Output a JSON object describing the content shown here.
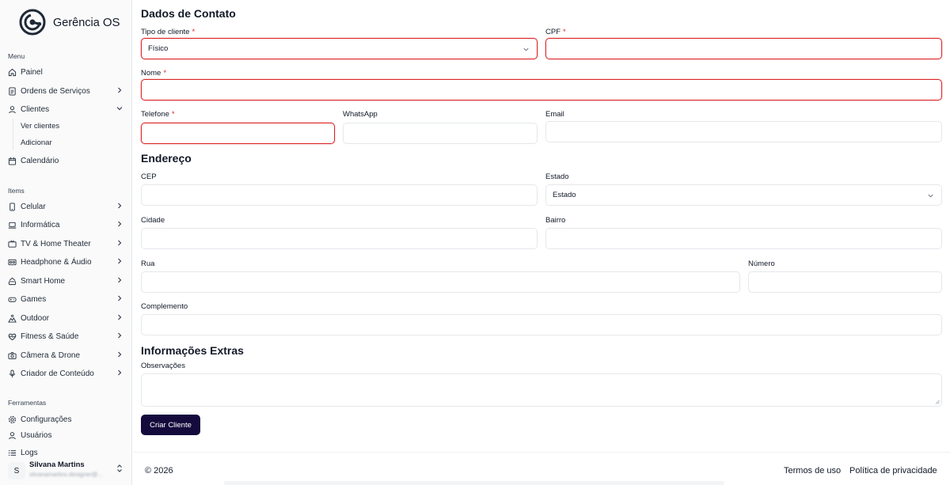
{
  "app": {
    "logo_main": "Gerência",
    "logo_bold": "OS"
  },
  "sidebar": {
    "menu_label": "Menu",
    "menu_items": [
      {
        "label": "Painel",
        "icon": "home-icon"
      },
      {
        "label": "Ordens de Serviços",
        "icon": "document-icon"
      },
      {
        "label": "Clientes",
        "icon": "user-icon"
      }
    ],
    "clientes_sub": [
      "Ver clientes",
      "Adicionar"
    ],
    "calendar_label": "Calendário",
    "items_label": "Items",
    "items": [
      {
        "label": "Celular",
        "icon": "smartphone-icon"
      },
      {
        "label": "Informática",
        "icon": "laptop-icon"
      },
      {
        "label": "TV & Home Theater",
        "icon": "tv-icon"
      },
      {
        "label": "Headphone & Áudio",
        "icon": "speaker-icon"
      },
      {
        "label": "Smart Home",
        "icon": "smart-home-icon"
      },
      {
        "label": "Games",
        "icon": "gamepad-icon"
      },
      {
        "label": "Outdoor",
        "icon": "outdoor-icon"
      },
      {
        "label": "Fitness & Saúde",
        "icon": "heart-pulse-icon"
      },
      {
        "label": "Câmera & Drone",
        "icon": "camera-icon"
      },
      {
        "label": "Criador de Conteúdo",
        "icon": "mic-icon"
      }
    ],
    "tools_label": "Ferramentas",
    "tools": [
      {
        "label": "Configurações",
        "icon": "gear-icon"
      },
      {
        "label": "Usuários",
        "icon": "user-icon"
      },
      {
        "label": "Logs",
        "icon": "list-icon"
      }
    ],
    "user": {
      "initial": "S",
      "name": "Silvana Martins",
      "email": "silvanamartins.designer@..."
    }
  },
  "form": {
    "contact_title": "Dados de Contato",
    "tipo_label": "Tipo de cliente",
    "tipo_value": "Físico",
    "cpf_label": "CPF",
    "nome_label": "Nome",
    "telefone_label": "Telefone",
    "whatsapp_label": "WhatsApp",
    "email_label": "Email",
    "required_mark": "*",
    "address_title": "Endereço",
    "cep_label": "CEP",
    "estado_label": "Estado",
    "estado_value": "Estado",
    "cidade_label": "Cidade",
    "bairro_label": "Bairro",
    "rua_label": "Rua",
    "numero_label": "Número",
    "complemento_label": "Complemento",
    "extras_title": "Informações Extras",
    "obs_label": "Observações",
    "submit_label": "Criar Cliente"
  },
  "footer": {
    "copyright": "© 2026",
    "terms": "Termos de uso",
    "privacy": "Política de privacidade"
  },
  "colors": {
    "error": "#dc2626",
    "primary_button": "#140a3c",
    "logo": "#1f2937"
  }
}
